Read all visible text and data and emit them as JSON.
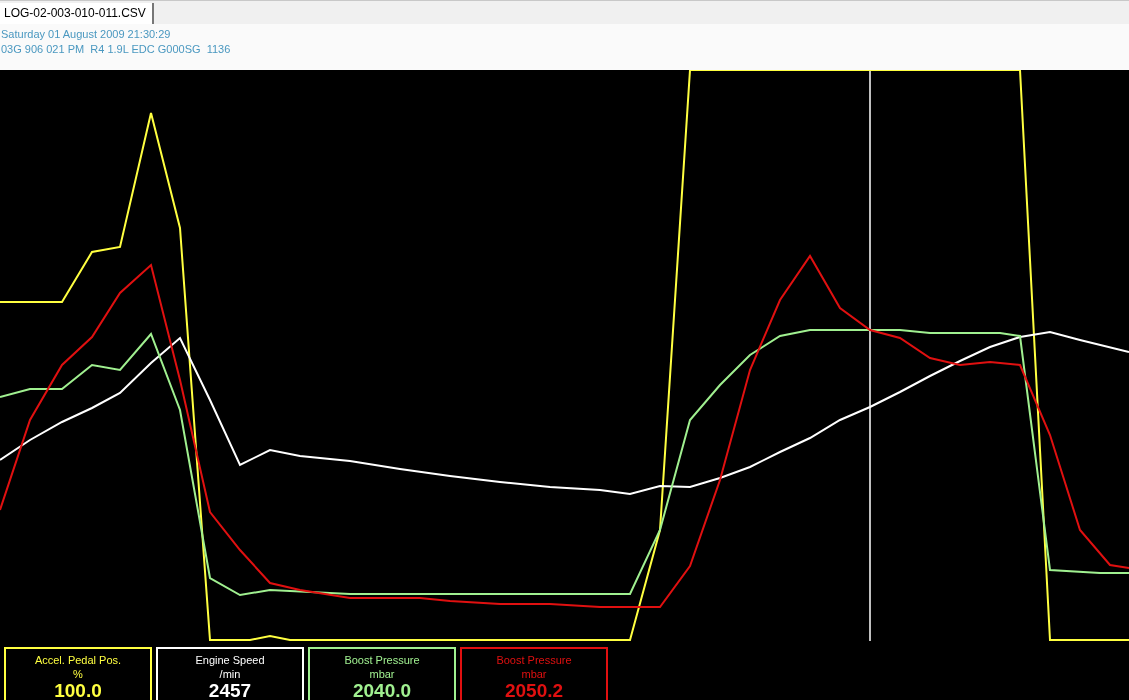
{
  "tabs": [
    {
      "label": "LOG-02-003-010-011.CSV",
      "selected": true
    }
  ],
  "header": {
    "date": "Saturday 01 August 2009 21:30:29",
    "ecu": "03G 906 021 PM  R4 1.9L EDC G000SG  1136"
  },
  "channels": [
    {
      "name": "Accel. Pedal Pos.",
      "unit": "%",
      "value": "100.0",
      "color": "#ffff40"
    },
    {
      "name": "Engine Speed",
      "unit": "/min",
      "value": "2457",
      "color": "#ffffff"
    },
    {
      "name": "Boost Pressure",
      "unit": "mbar",
      "value": "2040.0",
      "color": "#a0f090"
    },
    {
      "name": "Boost Pressure",
      "unit": "mbar",
      "value": "2050.2",
      "color": "#e01010"
    }
  ]
}
